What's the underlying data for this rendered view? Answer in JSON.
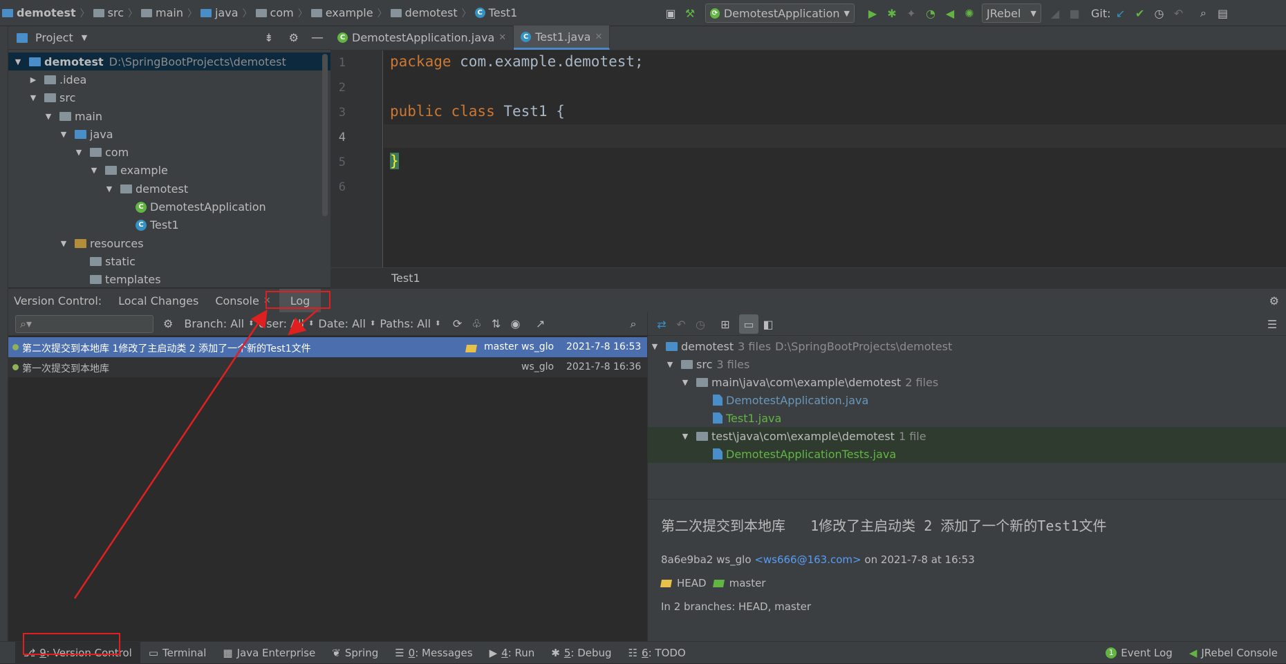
{
  "breadcrumb": {
    "items": [
      "demotest",
      "src",
      "main",
      "java",
      "com",
      "example",
      "demotest",
      "Test1"
    ]
  },
  "toolbar": {
    "run_config": "DemotestApplication",
    "jrebel": "JRebel",
    "git_label": "Git:"
  },
  "project_panel": {
    "title": "Project",
    "root_name": "demotest",
    "root_path": "D:\\SpringBootProjects\\demotest",
    "tree": [
      {
        "label": "demotest",
        "depth": 0,
        "expanded": true,
        "icon": "module-folder-icon"
      },
      {
        "label": ".idea",
        "depth": 1,
        "expanded": false,
        "icon": "folder-icon"
      },
      {
        "label": "src",
        "depth": 1,
        "expanded": true,
        "icon": "folder-icon"
      },
      {
        "label": "main",
        "depth": 2,
        "expanded": true,
        "icon": "folder-icon"
      },
      {
        "label": "java",
        "depth": 3,
        "expanded": true,
        "icon": "source-folder-icon"
      },
      {
        "label": "com",
        "depth": 4,
        "expanded": true,
        "icon": "package-icon"
      },
      {
        "label": "example",
        "depth": 5,
        "expanded": true,
        "icon": "package-icon"
      },
      {
        "label": "demotest",
        "depth": 6,
        "expanded": true,
        "icon": "package-icon"
      },
      {
        "label": "DemotestApplication",
        "depth": 7,
        "expanded": null,
        "icon": "spring-class-icon"
      },
      {
        "label": "Test1",
        "depth": 7,
        "expanded": null,
        "icon": "class-icon"
      },
      {
        "label": "resources",
        "depth": 3,
        "expanded": true,
        "icon": "resources-folder-icon"
      },
      {
        "label": "static",
        "depth": 4,
        "expanded": null,
        "icon": "folder-icon"
      },
      {
        "label": "templates",
        "depth": 4,
        "expanded": null,
        "icon": "folder-icon"
      }
    ]
  },
  "editor": {
    "tabs": [
      {
        "label": "DemotestApplication.java",
        "active": false
      },
      {
        "label": "Test1.java",
        "active": true
      }
    ],
    "lines": [
      {
        "num": "1",
        "kw": "package",
        "text": " com.example.demotest;"
      },
      {
        "num": "2",
        "kw": "",
        "text": ""
      },
      {
        "num": "3",
        "kw": "public class",
        "text": " Test1 {"
      },
      {
        "num": "4",
        "kw": "",
        "text": ""
      },
      {
        "num": "5",
        "kw": "",
        "text": "}"
      },
      {
        "num": "6",
        "kw": "",
        "text": ""
      }
    ],
    "breadcrumb": "Test1"
  },
  "vc_panel": {
    "label": "Version Control:",
    "tabs": [
      "Local Changes",
      "Console",
      "Log"
    ],
    "filters": [
      "Branch: All",
      "User: All",
      "Date: All",
      "Paths: All"
    ]
  },
  "log": {
    "commits": [
      {
        "message": "第二次提交到本地库  1修改了主启动类 2 添加了一个新的Test1文件",
        "branch": "master",
        "author": "ws_glo",
        "date": "2021-7-8 16:53",
        "selected": true
      },
      {
        "message": "第一次提交到本地库",
        "branch": "",
        "author": "ws_glo",
        "date": "2021-7-8 16:36",
        "selected": false
      }
    ]
  },
  "changes": {
    "root": {
      "name": "demotest",
      "count": "3 files",
      "path": "D:\\SpringBootProjects\\demotest"
    },
    "src": {
      "name": "src",
      "count": "3 files"
    },
    "main_pkg": {
      "name": "main\\java\\com\\example\\demotest",
      "count": "2 files"
    },
    "main_files": [
      "DemotestApplication.java",
      "Test1.java"
    ],
    "test_pkg": {
      "name": "test\\java\\com\\example\\demotest",
      "count": "1 file"
    },
    "test_files": [
      "DemotestApplicationTests.java"
    ]
  },
  "details": {
    "title": "第二次提交到本地库   1修改了主启动类 2 添加了一个新的Test1文件",
    "hash_author": "8a6e9ba2 ws_glo",
    "email": "<ws666@163.com>",
    "when": "on 2021-7-8 at 16:53",
    "refs": [
      "HEAD",
      "master"
    ],
    "branches": "In 2 branches: HEAD, master"
  },
  "bottom_tools": [
    {
      "mnemonic": "9",
      "label": ": Version Control",
      "active": true
    },
    {
      "mnemonic": "",
      "label": "Terminal",
      "active": false
    },
    {
      "mnemonic": "",
      "label": "Java Enterprise",
      "active": false
    },
    {
      "mnemonic": "",
      "label": "Spring",
      "active": false
    },
    {
      "mnemonic": "0",
      "label": ": Messages",
      "active": false
    },
    {
      "mnemonic": "4",
      "label": ": Run",
      "active": false
    },
    {
      "mnemonic": "5",
      "label": ": Debug",
      "active": false
    },
    {
      "mnemonic": "6",
      "label": ": TODO",
      "active": false
    }
  ],
  "bottom_right": {
    "event_log": "Event Log",
    "jrebel_console": "JRebel Console"
  },
  "colors": {
    "annotation_red": "#e02020",
    "selection_blue": "#4b6eaf",
    "added_green": "#62b543"
  }
}
